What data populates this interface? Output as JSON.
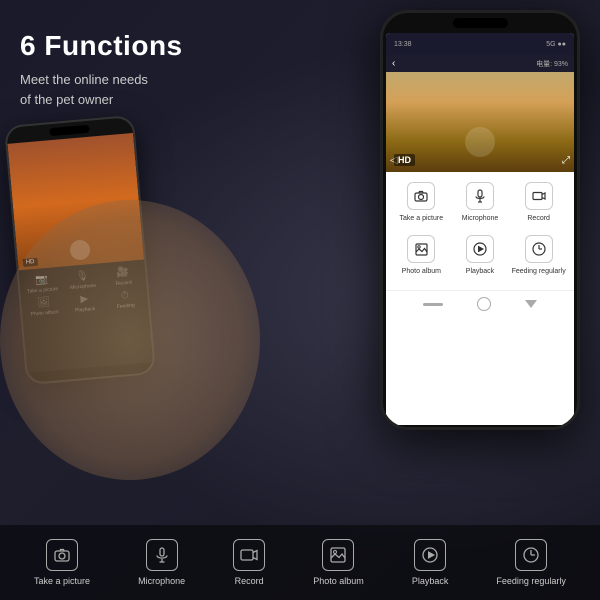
{
  "page": {
    "title": "6 Functions",
    "subtitle_line1": "Meet the online needs",
    "subtitle_line2": "of the pet owner"
  },
  "large_phone": {
    "status_bar": {
      "time": "13:38",
      "signal": "5G",
      "battery": "●●"
    },
    "cam_bar": {
      "back_label": "‹",
      "percent": "电量: 93%"
    },
    "hd_label": "HD",
    "controls": [
      {
        "id": "take-picture",
        "icon": "📷",
        "label": "Take a picture"
      },
      {
        "id": "microphone",
        "icon": "🎙",
        "label": "Microphone"
      },
      {
        "id": "record",
        "icon": "🎥",
        "label": "Record"
      },
      {
        "id": "photo-album",
        "icon": "🖼",
        "label": "Photo album"
      },
      {
        "id": "playback",
        "icon": "▶",
        "label": "Playback"
      },
      {
        "id": "feeding",
        "icon": "⏱",
        "label": "Feeding regularly"
      }
    ]
  },
  "bottom_bar": {
    "items": [
      {
        "id": "take-picture",
        "icon": "📷",
        "label": "Take a picture"
      },
      {
        "id": "microphone",
        "icon": "🎙",
        "label": "Microphone"
      },
      {
        "id": "record",
        "icon": "🎥",
        "label": "Record"
      },
      {
        "id": "photo-album",
        "icon": "🖼",
        "label": "Photo album"
      },
      {
        "id": "playback",
        "icon": "▶",
        "label": "Playback"
      },
      {
        "id": "feeding-regularly",
        "icon": "⏱",
        "label": "Feeding regularly"
      }
    ]
  },
  "icons": {
    "camera": "⊙",
    "microphone": "♪",
    "record": "⬛",
    "photo_album": "◻",
    "playback": "▶",
    "feeding": "◷",
    "back_arrow": "‹",
    "hd_icon": "HD",
    "expand": "⤢",
    "collapse": "⤡"
  }
}
